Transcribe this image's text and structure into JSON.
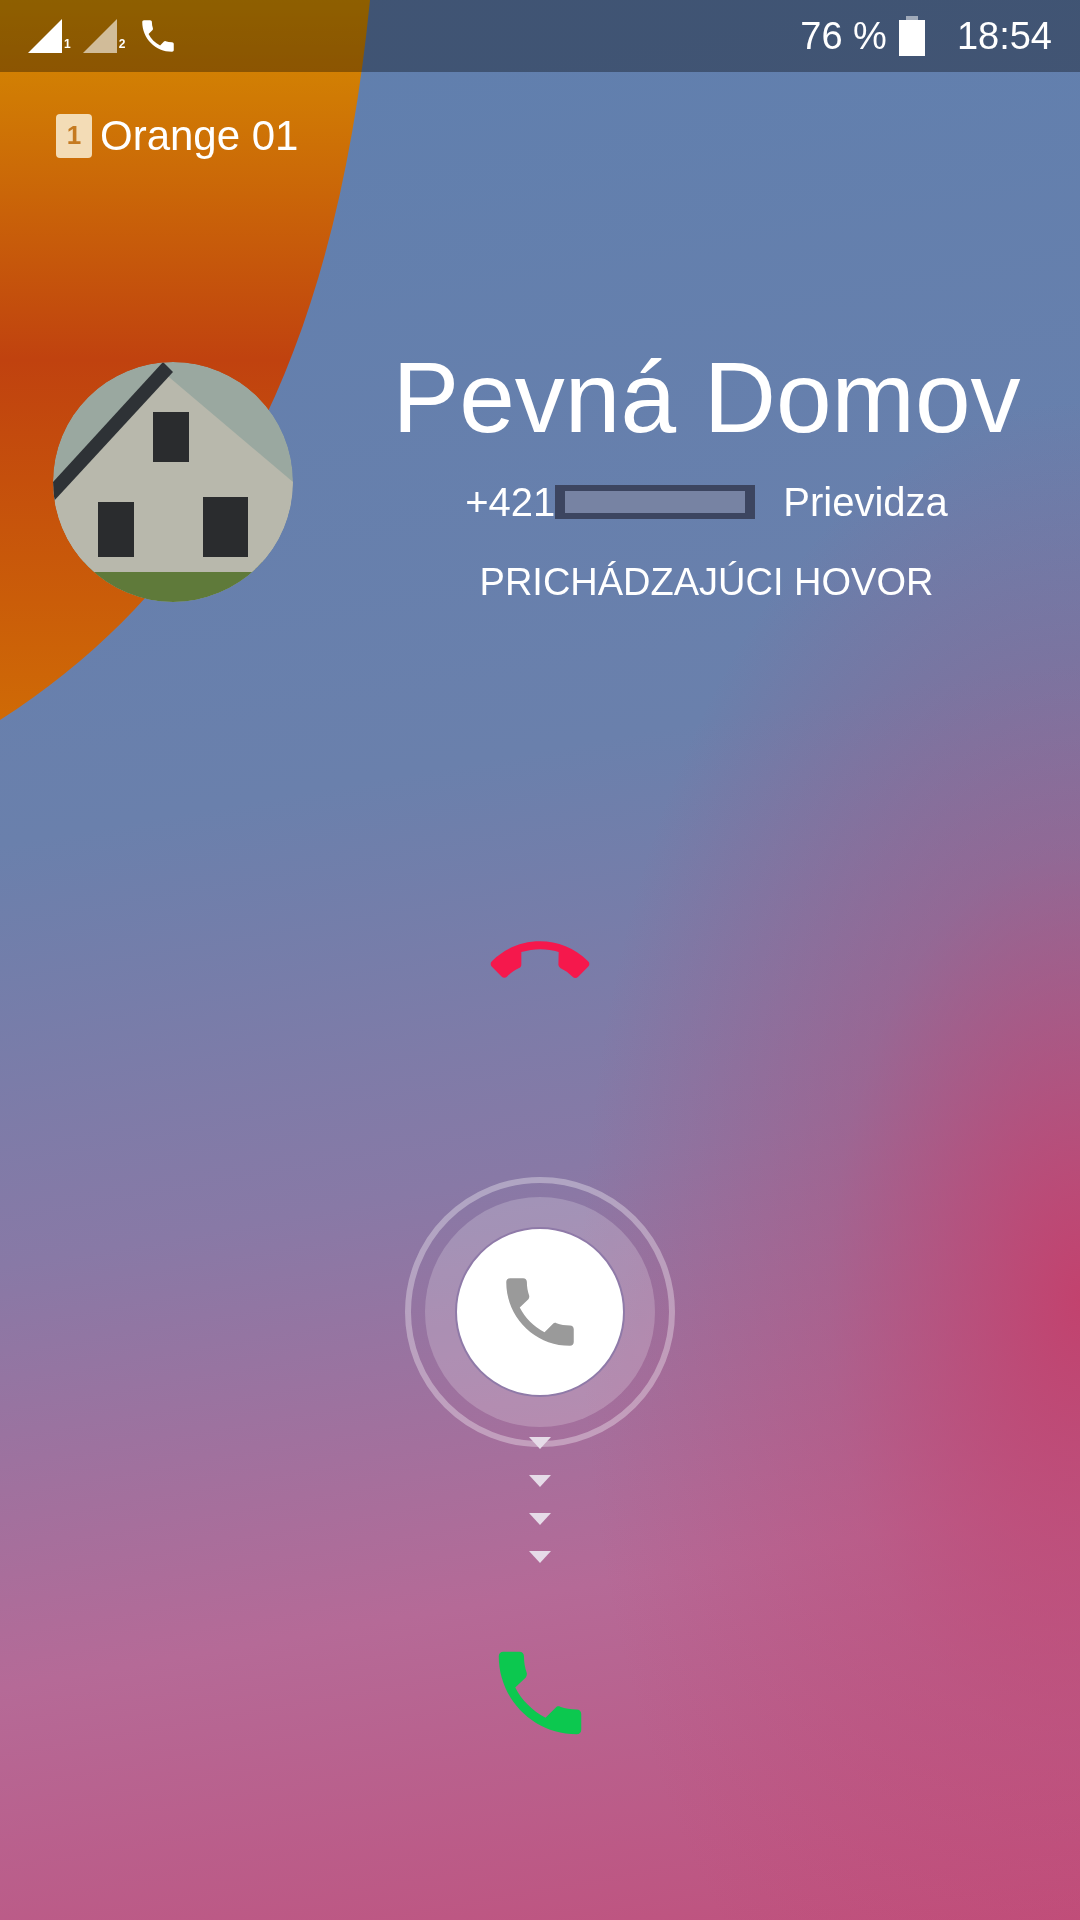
{
  "status_bar": {
    "signal_slots": [
      "1",
      "2"
    ],
    "in_call": true,
    "battery": "76 %",
    "time": "18:54"
  },
  "sim": {
    "slot": "1",
    "carrier": "Orange 01"
  },
  "caller": {
    "name": "Pevná Domov",
    "number": "+421",
    "number_redacted": true,
    "location": "Prievidza",
    "status": "PRICHÁDZAJÚCI HOVOR"
  }
}
